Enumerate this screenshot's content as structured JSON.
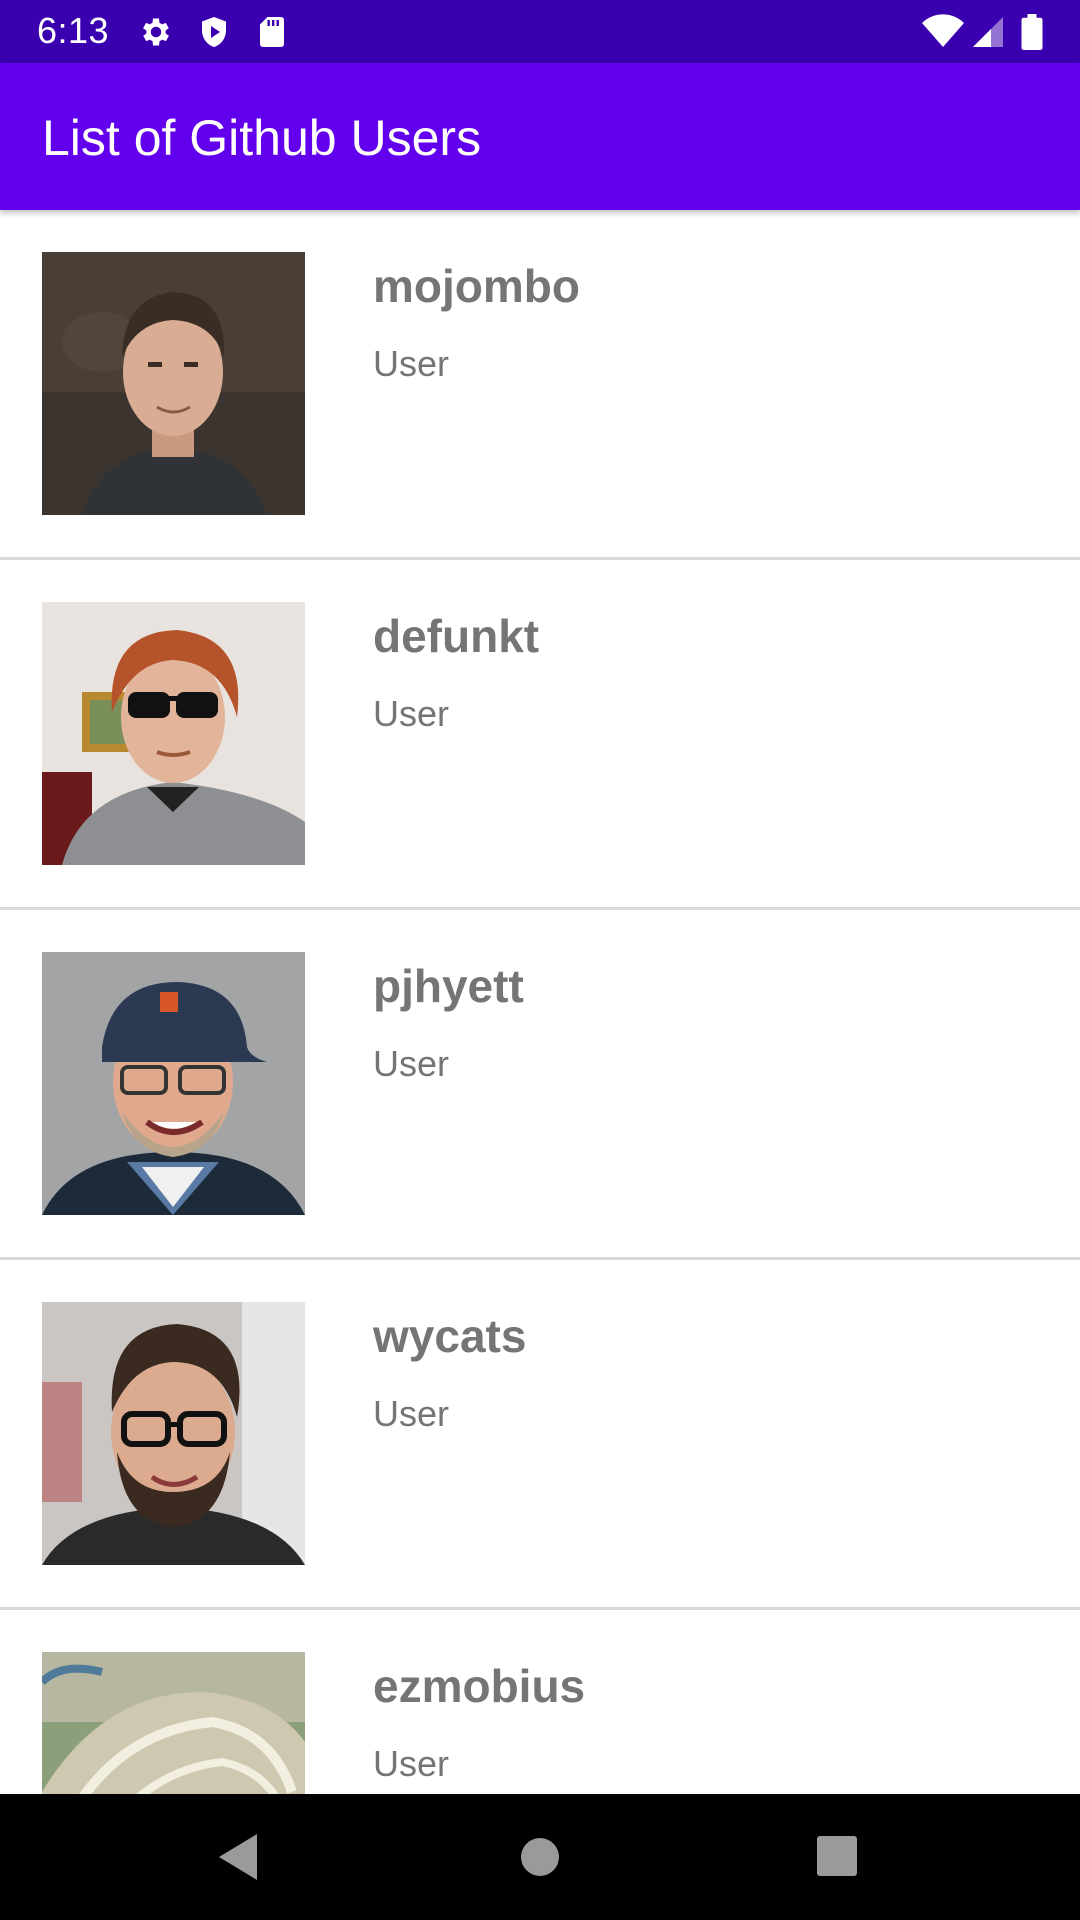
{
  "status_bar": {
    "time": "6:13",
    "left_icons": [
      "gear-icon",
      "shield-icon",
      "sd-card-icon"
    ],
    "right_icons": [
      "wifi-icon",
      "signal-icon",
      "battery-icon"
    ]
  },
  "app_bar": {
    "title": "List of Github Users"
  },
  "users": [
    {
      "login": "mojombo",
      "type": "User"
    },
    {
      "login": "defunkt",
      "type": "User"
    },
    {
      "login": "pjhyett",
      "type": "User"
    },
    {
      "login": "wycats",
      "type": "User"
    },
    {
      "login": "ezmobius",
      "type": "User"
    }
  ],
  "nav_bar": {
    "buttons": [
      "back-icon",
      "home-icon",
      "recents-icon"
    ]
  },
  "colors": {
    "status_bar": "#3a00b0",
    "app_bar": "#6200ee",
    "text_secondary": "#757575"
  }
}
